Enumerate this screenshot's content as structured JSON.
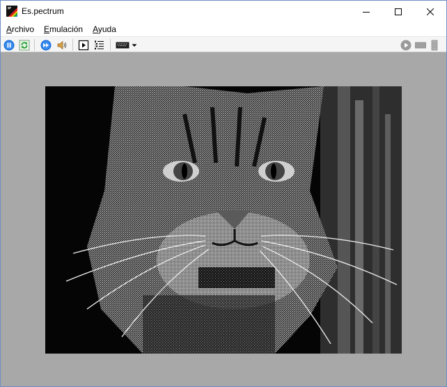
{
  "window": {
    "title": "Es.pectrum"
  },
  "menu": {
    "items": [
      {
        "label": "Archivo",
        "accel": "A",
        "rest": "rchivo"
      },
      {
        "label": "Emulación",
        "accel": "E",
        "rest": "mulación"
      },
      {
        "label": "Ayuda",
        "accel": "A",
        "rest": "yuda"
      }
    ]
  },
  "toolbar": {
    "icons": [
      "pause-icon",
      "refresh-icon",
      "fast-forward-icon",
      "speaker-icon",
      "step-icon",
      "debugger-icon",
      "keyboard-icon",
      "chevron-down-icon",
      "play-icon",
      "tape-icon",
      "scroll-icon"
    ]
  },
  "colors": {
    "accent_blue": "#1a6fd6",
    "border_area": "#a8a8a8",
    "screen_bg": "#000000"
  }
}
